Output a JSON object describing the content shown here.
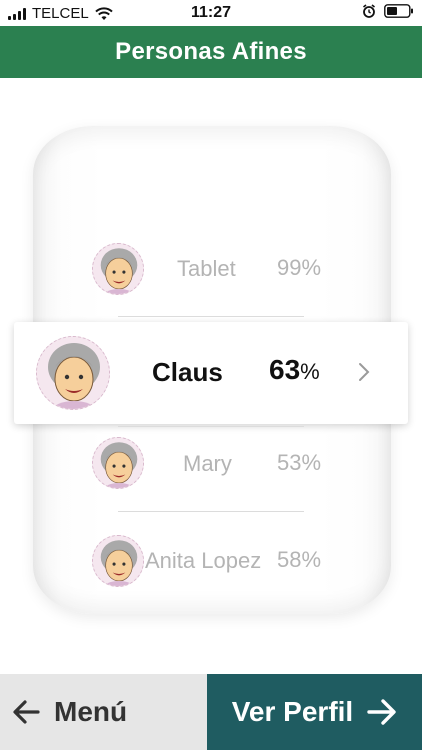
{
  "status_bar": {
    "carrier": "TELCEL",
    "time": "11:27",
    "icons": [
      "signal-bars-icon",
      "wifi-icon",
      "alarm-icon",
      "battery-icon"
    ]
  },
  "header": {
    "title": "Personas Afines",
    "background": "#2b8050"
  },
  "picker": {
    "items": [
      {
        "name": "Tablet",
        "percent": "99%"
      },
      {
        "name": "Claus",
        "percent_number": "63",
        "percent_sign": "%",
        "selected": true
      },
      {
        "name": "Mary",
        "percent": "53%"
      },
      {
        "name": "Anita Lopez",
        "percent": "58%"
      }
    ]
  },
  "footer": {
    "menu_label": "Menú",
    "menu_icon": "arrow-left-icon",
    "profile_label": "Ver Perfil",
    "profile_icon": "arrow-right-icon",
    "profile_background": "#1f5c61",
    "menu_background": "#e6e6e6"
  }
}
